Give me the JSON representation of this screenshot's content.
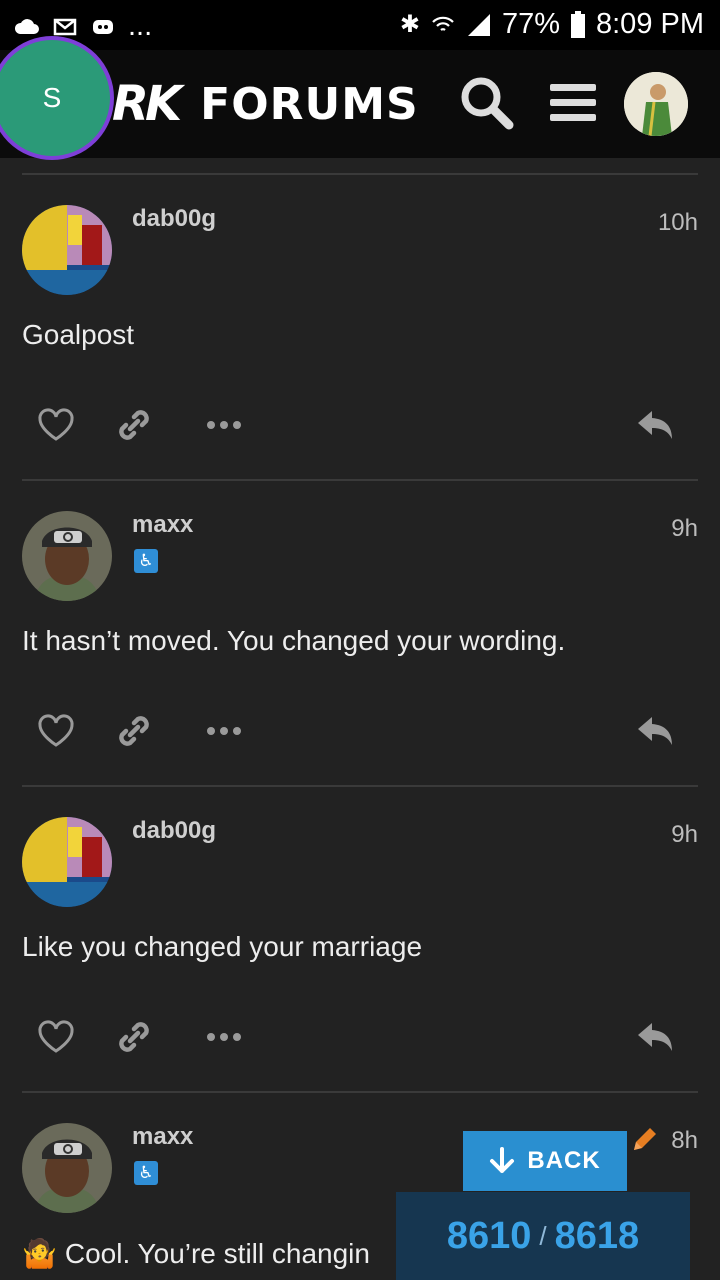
{
  "status_bar": {
    "battery": "77%",
    "time": "8:09 PM",
    "more": "..."
  },
  "header": {
    "logo_mark": "RK",
    "logo_text": "FORUMS",
    "user_initial": "S"
  },
  "posts": [
    {
      "username": "dab00g",
      "time": "10h",
      "body": "Goalpost",
      "badge": false
    },
    {
      "username": "maxx",
      "time": "9h",
      "body": "It hasn’t moved. You changed your wording.",
      "badge": true
    },
    {
      "username": "dab00g",
      "time": "9h",
      "body": "Like you changed your marriage",
      "badge": false
    },
    {
      "username": "maxx",
      "time": "8h",
      "body": "Cool. You’re still changin",
      "badge": true
    }
  ],
  "back_button": {
    "label": "BACK"
  },
  "progress": {
    "current": "8610",
    "separator": "/",
    "total": "8618"
  },
  "colors": {
    "accent": "#2a8fd0",
    "bubble": "#2b9a78",
    "bubble_border": "#7e3fd8",
    "edit": "#e67e22"
  }
}
